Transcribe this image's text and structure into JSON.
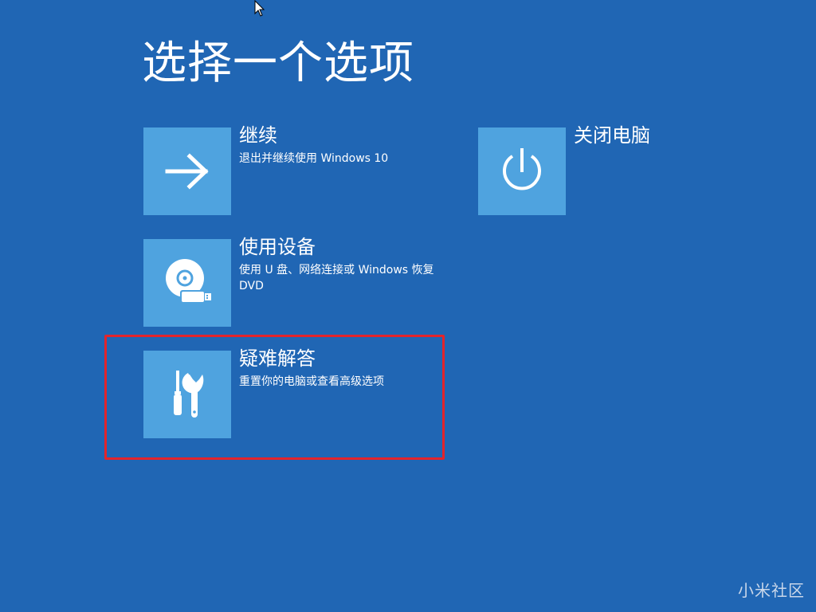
{
  "page": {
    "title": "选择一个选项"
  },
  "options": [
    {
      "id": "continue",
      "title": "继续",
      "description": "退出并继续使用 Windows 10",
      "icon": "arrow-right-icon"
    },
    {
      "id": "use_device",
      "title": "使用设备",
      "description": "使用 U 盘、网络连接或 Windows 恢复 DVD",
      "icon": "disc-usb-icon"
    },
    {
      "id": "troubleshoot",
      "title": "疑难解答",
      "description": "重置你的电脑或查看高级选项",
      "icon": "tools-icon",
      "highlighted": true
    },
    {
      "id": "shutdown",
      "title": "关闭电脑",
      "description": "",
      "icon": "power-icon"
    }
  ],
  "watermark": {
    "text": "小米社区"
  },
  "colors": {
    "background": "#2066b4",
    "tile": "#4fa3df",
    "highlight": "#e3242b",
    "text": "#ffffff"
  }
}
